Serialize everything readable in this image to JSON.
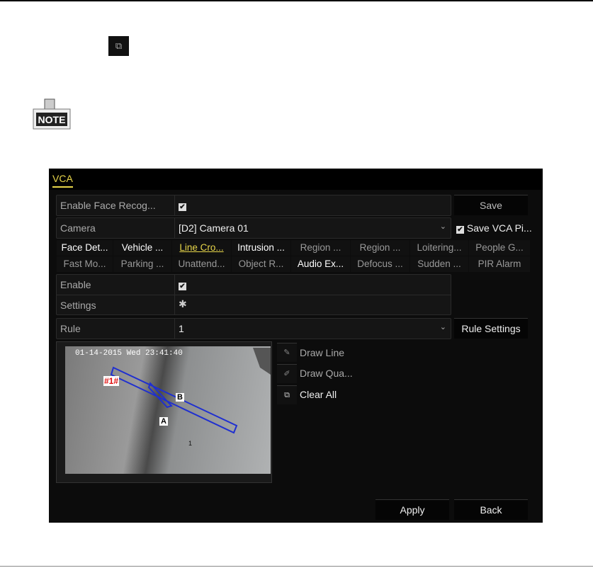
{
  "page": {
    "clear_icon": "clear-all-icon",
    "note_label": "NOTE"
  },
  "vca": {
    "title": "VCA",
    "enable_face_label": "Enable Face Recog...",
    "save_label": "Save",
    "camera_label": "Camera",
    "camera_value": "[D2] Camera 01",
    "save_pic_label": "Save VCA Pi...",
    "tabs_row1": [
      "Face Det...",
      "Vehicle ...",
      "Line Cro...",
      "Intrusion ...",
      "Region ...",
      "Region ...",
      "Loitering...",
      "People G..."
    ],
    "tabs_row2": [
      "Fast Mo...",
      "Parking ...",
      "Unattend...",
      "Object R...",
      "Audio Ex...",
      "Defocus ...",
      "Sudden ...",
      "PIR Alarm"
    ],
    "active_tab": "Line Cro...",
    "enable_label": "Enable",
    "settings_label": "Settings",
    "rule_label": "Rule",
    "rule_value": "1",
    "rule_settings_label": "Rule Settings",
    "osd_time": "01-14-2015 Wed 23:41:40",
    "rule_tag": "#1#",
    "point_a": "A",
    "point_b": "B",
    "cam_number": "1",
    "draw_line_label": "Draw Line",
    "draw_quad_label": "Draw Qua...",
    "clear_all_label": "Clear All",
    "apply_label": "Apply",
    "back_label": "Back",
    "accent_color": "#e8d64a"
  }
}
